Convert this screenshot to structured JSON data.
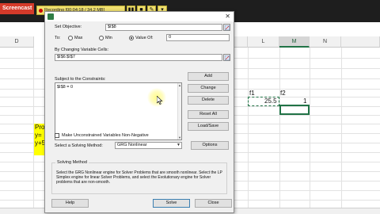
{
  "recorder": {
    "logo": "Screencast",
    "status": "Recording [00:04:18 / 34.2 MB]",
    "controls": [
      "▮▮",
      "■",
      "✎",
      "▾"
    ]
  },
  "excel": {
    "columns": [
      "D",
      "L",
      "M",
      "N"
    ],
    "selected_column": "M",
    "cells": {
      "f1_label": "f1",
      "f2_label": "f2",
      "f1_value": "25.5",
      "f2_value": "1"
    },
    "yellow_lines": [
      "Pro",
      "y=",
      "y+5"
    ]
  },
  "dialog": {
    "title_icon": "excel-icon",
    "close_glyph": "✕",
    "set_objective_label": "Set Objective:",
    "set_objective_value": "$I$8",
    "to_label": "To:",
    "max_label": "Max",
    "min_label": "Min",
    "value_of_label": "Value Of:",
    "value_of_value": "0",
    "to_selected": "value_of",
    "changing_cells_label": "By Changing Variable Cells:",
    "changing_cells_value": "$I$6:$I$7",
    "constraints_label": "Subject to the Constraints:",
    "constraints": [
      "$I$8 = 0"
    ],
    "buttons_right": [
      "Add",
      "Change",
      "Delete",
      "Reset All",
      "Load/Save"
    ],
    "unconstrained_label": "Make Unconstrained Variables Non-Negative",
    "unconstrained_checked": false,
    "method_label": "Select a Solving Method:",
    "method_value": "GRG Nonlinear",
    "options_label": "Options",
    "solving_method_title": "Solving Method",
    "solving_method_desc": "Select the GRG Nonlinear engine for Solver Problems that are smooth nonlinear. Select the LP Simplex engine for linear Solver Problems, and select the Evolutionary engine for Solver problems that are non-smooth.",
    "help_label": "Help",
    "solve_label": "Solve",
    "close_label": "Close"
  }
}
